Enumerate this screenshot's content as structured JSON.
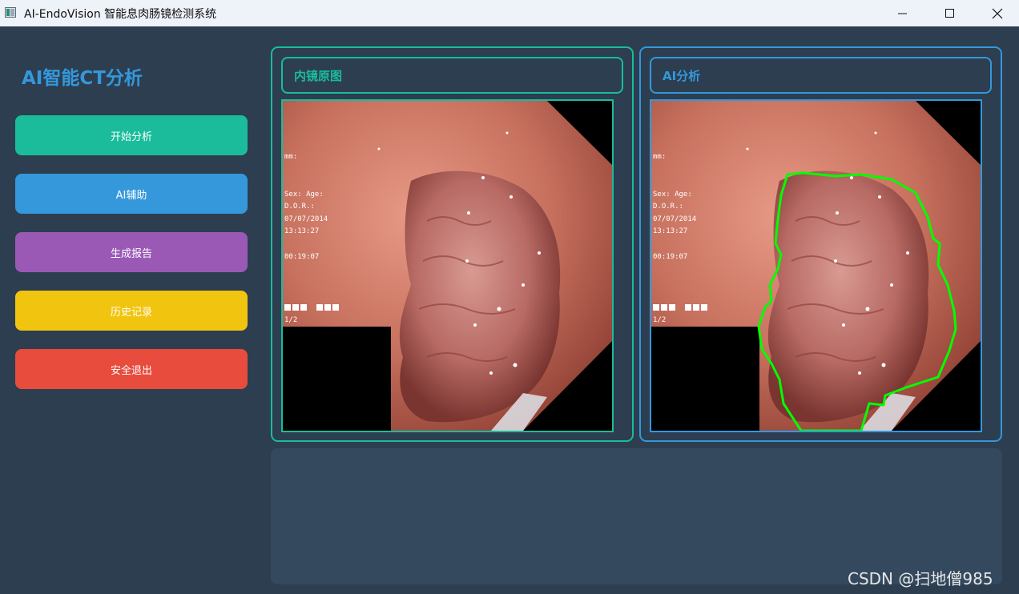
{
  "window": {
    "title": "AI-EndoVision 智能息肉肠镜检测系统"
  },
  "sidebar": {
    "title": "AI智能CT分析",
    "buttons": [
      {
        "label": "开始分析",
        "color": "#1abc9c"
      },
      {
        "label": "AI辅助",
        "color": "#3498db"
      },
      {
        "label": "生成报告",
        "color": "#9b59b6"
      },
      {
        "label": "历史记录",
        "color": "#f1c40f"
      },
      {
        "label": "安全退出",
        "color": "#e74c3c"
      }
    ]
  },
  "panels": {
    "original": {
      "title": "内镜原图",
      "accent": "#1abc9c"
    },
    "analysis": {
      "title": "AI分析",
      "accent": "#3498db",
      "contour_color": "#00ff00"
    }
  },
  "overlay_text": {
    "line1": "mm:",
    "line2": "Sex:    Age:",
    "line3": "D.O.R.:",
    "line4": "07/07/2014",
    "line5": "13:13:27",
    "line6": "00:19:07",
    "line7": "1/2"
  },
  "result": {
    "text": ""
  },
  "watermark": "CSDN @扫地僧985",
  "icons": {
    "app": "app-icon",
    "minimize": "minimize-icon",
    "maximize": "maximize-icon",
    "close": "close-icon"
  }
}
